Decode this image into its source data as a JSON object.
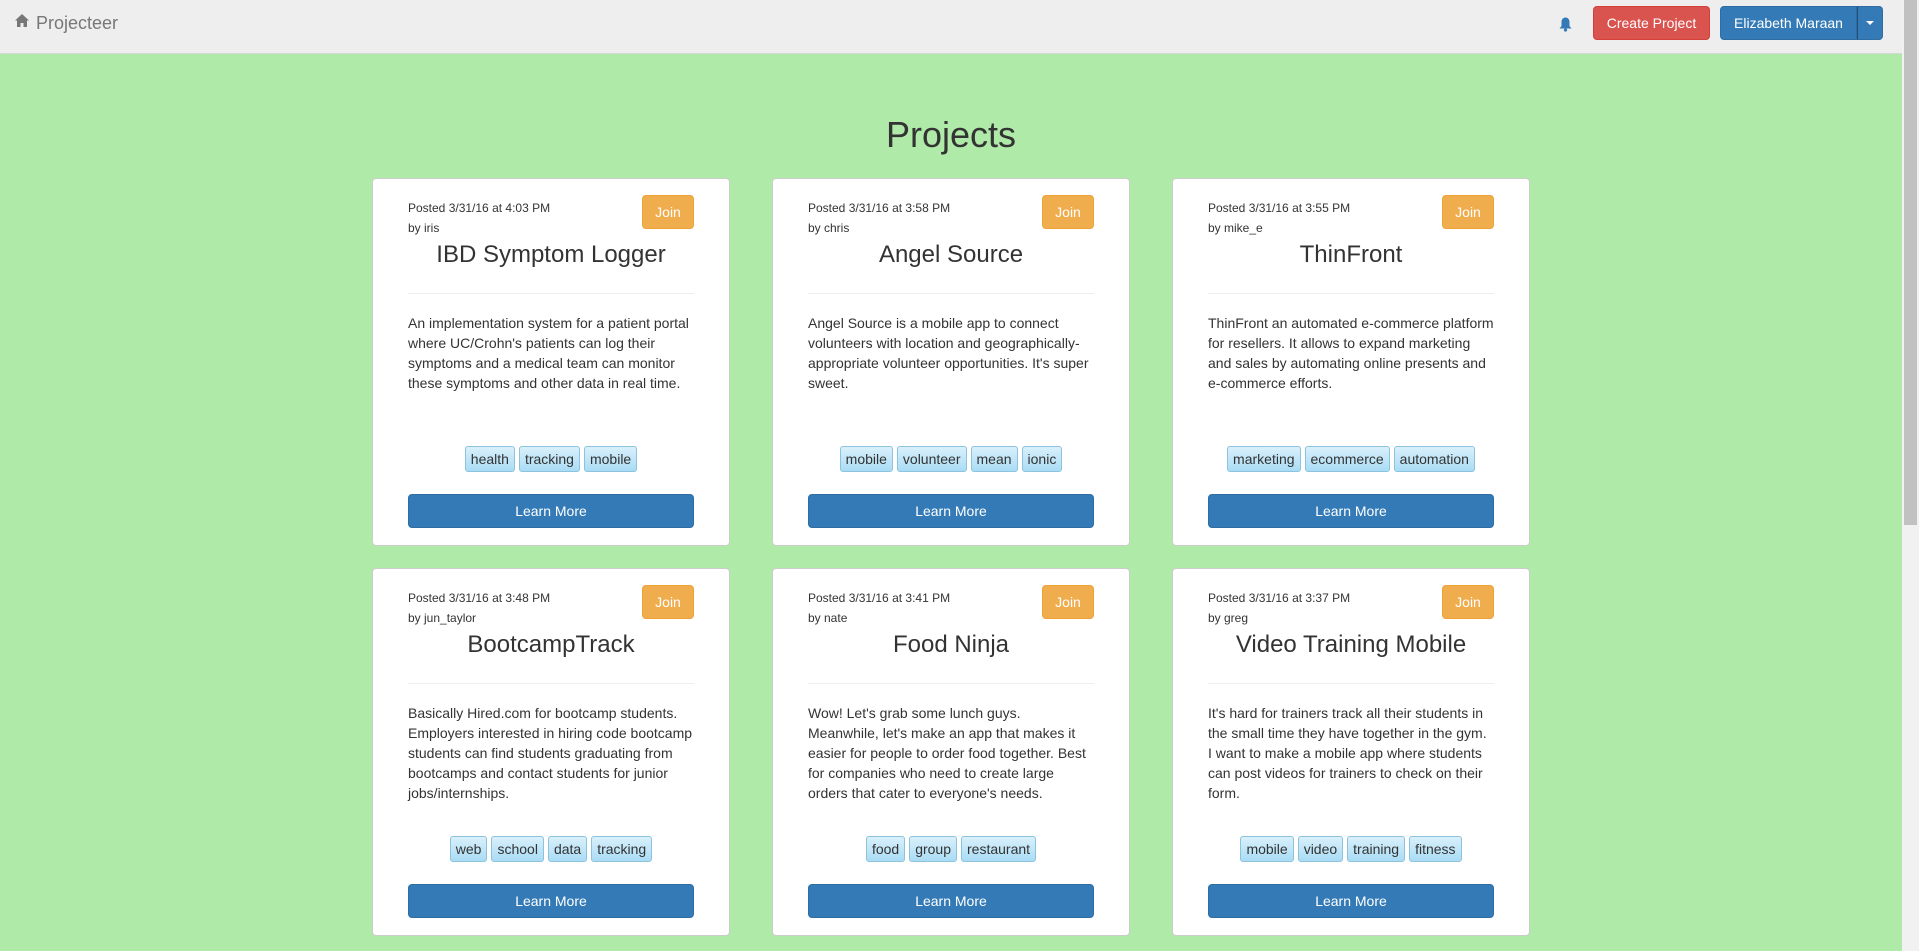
{
  "navbar": {
    "brand": "Projecteer",
    "brand_icon": "home-icon",
    "notification_icon": "bell-icon",
    "create_label": "Create Project",
    "user_label": "Elizabeth Maraan"
  },
  "colors": {
    "page_bg": "#b0eaa9",
    "primary": "#337ab7",
    "danger": "#d9534f",
    "warning": "#f0ad4e"
  },
  "main": {
    "title": "Projects"
  },
  "projects": [
    {
      "posted": "Posted 3/31/16 at 4:03 PM",
      "by": "by iris",
      "title": "IBD Symptom Logger",
      "description": "An implementation system for a patient portal where UC/Crohn's patients can log their symptoms and a medical team can monitor these symptoms and other data in real time.",
      "tags": [
        "health",
        "tracking",
        "mobile"
      ],
      "join_label": "Join",
      "learn_label": "Learn More"
    },
    {
      "posted": "Posted 3/31/16 at 3:58 PM",
      "by": "by chris",
      "title": "Angel Source",
      "description": "Angel Source is a mobile app to connect volunteers with location and geographically-appropriate volunteer opportunities. It's super sweet.",
      "tags": [
        "mobile",
        "volunteer",
        "mean",
        "ionic"
      ],
      "join_label": "Join",
      "learn_label": "Learn More"
    },
    {
      "posted": "Posted 3/31/16 at 3:55 PM",
      "by": "by mike_e",
      "title": "ThinFront",
      "description": "ThinFront an automated e-commerce platform for resellers. It allows to expand marketing and sales by automating online presents and e-commerce efforts.",
      "tags": [
        "marketing",
        "ecommerce",
        "automation"
      ],
      "join_label": "Join",
      "learn_label": "Learn More"
    },
    {
      "posted": "Posted 3/31/16 at 3:48 PM",
      "by": "by jun_taylor",
      "title": "BootcampTrack",
      "description": "Basically Hired.com for bootcamp students. Employers interested in hiring code bootcamp students can find students graduating from bootcamps and contact students for junior jobs/internships.",
      "tags": [
        "web",
        "school",
        "data",
        "tracking"
      ],
      "join_label": "Join",
      "learn_label": "Learn More"
    },
    {
      "posted": "Posted 3/31/16 at 3:41 PM",
      "by": "by nate",
      "title": "Food Ninja",
      "description": "Wow! Let's grab some lunch guys. Meanwhile, let's make an app that makes it easier for people to order food together. Best for companies who need to create large orders that cater to everyone's needs.",
      "tags": [
        "food",
        "group",
        "restaurant"
      ],
      "join_label": "Join",
      "learn_label": "Learn More"
    },
    {
      "posted": "Posted 3/31/16 at 3:37 PM",
      "by": "by greg",
      "title": "Video Training Mobile",
      "description": "It's hard for trainers track all their students in the small time they have together in the gym. I want to make a mobile app where students can post videos for trainers to check on their form.",
      "tags": [
        "mobile",
        "video",
        "training",
        "fitness"
      ],
      "join_label": "Join",
      "learn_label": "Learn More"
    }
  ]
}
